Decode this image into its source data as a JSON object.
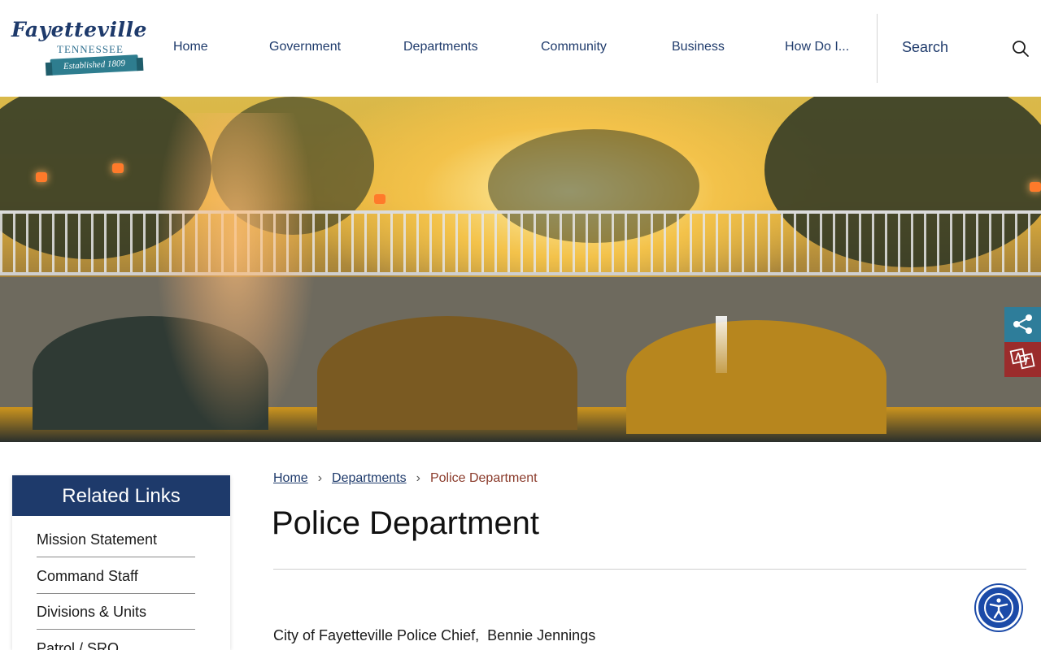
{
  "logo": {
    "script": "Fayetteville",
    "state": "TENNESSEE",
    "established": "Established 1809"
  },
  "nav": {
    "items": [
      "Home",
      "Government",
      "Departments",
      "Community",
      "Business",
      "How Do I..."
    ]
  },
  "search": {
    "label": "Search",
    "icon": "search-icon"
  },
  "side_buttons": {
    "share_icon": "share-icon",
    "translate_icon": "translate-icon"
  },
  "related_links": {
    "title": "Related Links",
    "items": [
      "Mission Statement",
      "Command Staff",
      "Divisions & Units",
      "Patrol / SRO"
    ]
  },
  "breadcrumb": {
    "home": "Home",
    "departments": "Departments",
    "current": "Police Department",
    "separator": "›"
  },
  "page": {
    "title": "Police Department",
    "body": "City of Fayetteville Police Chief,  Bennie Jennings"
  },
  "accessibility": {
    "icon": "accessibility-icon"
  },
  "colors": {
    "brand_navy": "#1e3a6b",
    "share_teal": "#2e7d9a",
    "translate_red": "#9b2c2c",
    "accessibility_blue": "#1b4aa8",
    "breadcrumb_current": "#8a3a2a"
  }
}
